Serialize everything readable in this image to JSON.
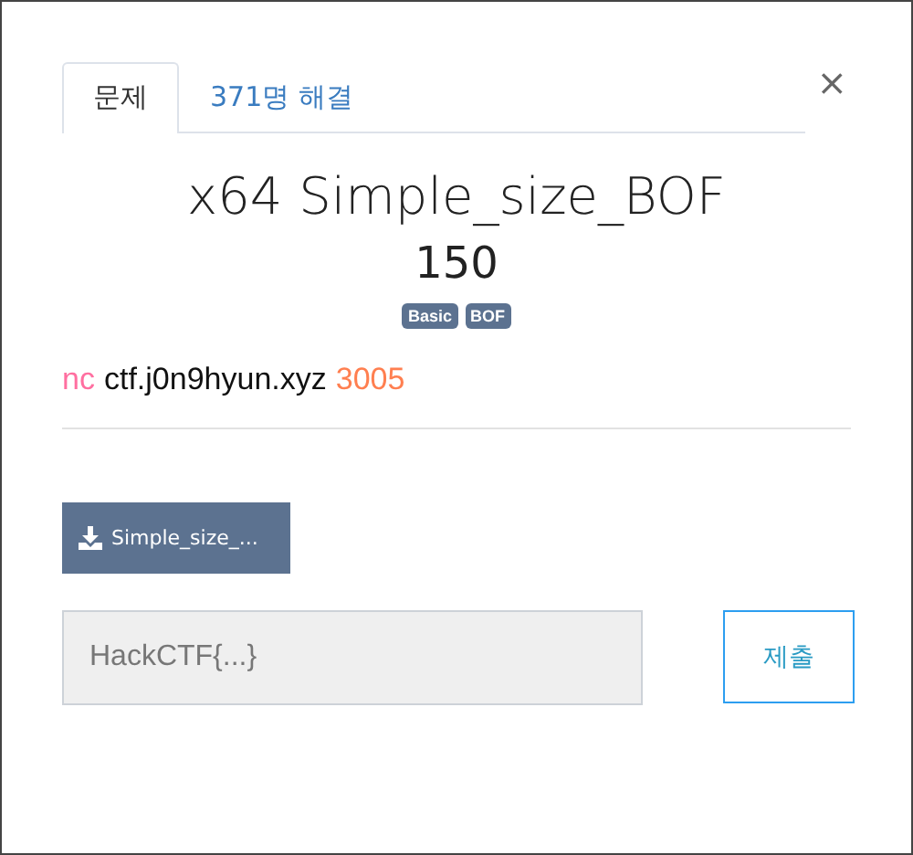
{
  "tabs": [
    {
      "label": "문제",
      "selected": true
    },
    {
      "label": "371명 해결",
      "selected": false
    }
  ],
  "close": "×",
  "title": "x64 Simple_size_BOF",
  "points": "150",
  "tags": [
    "Basic",
    "BOF"
  ],
  "connection": [
    {
      "kind": "command",
      "text": "nc"
    },
    {
      "kind": "host",
      "text": "ctf.j0n9hyun.xyz"
    },
    {
      "kind": "port",
      "text": "3005"
    }
  ],
  "download": {
    "label": "Simple_size_..."
  },
  "flag": {
    "placeholder": "HackCTF{...}"
  },
  "submit": "제출"
}
